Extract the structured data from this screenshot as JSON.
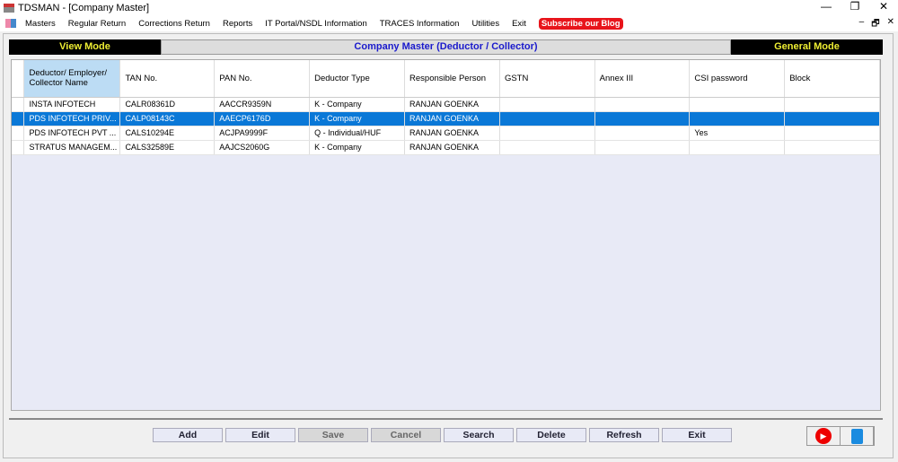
{
  "window": {
    "title": "TDSMAN - [Company Master]",
    "controls": [
      "—",
      "❐",
      "✕"
    ],
    "mdi_controls": [
      "–",
      "🗗",
      "✕"
    ]
  },
  "menu": [
    "Masters",
    "Regular Return",
    "Corrections Return",
    "Reports",
    "IT Portal/NSDL Information",
    "TRACES Information",
    "Utilities",
    "Exit"
  ],
  "blog_label": "Subscribe our Blog",
  "modebar": {
    "left": "View Mode",
    "center": "Company Master (Deductor / Collector)",
    "right": "General Mode"
  },
  "columns": [
    "Deductor/ Employer/ Collector Name",
    "TAN No.",
    "PAN No.",
    "Deductor Type",
    "Responsible Person",
    "GSTN",
    "Annex III",
    "CSI password",
    "Block"
  ],
  "rows": [
    [
      "INSTA INFOTECH",
      "CALR08361D",
      "AACCR9359N",
      "K - Company",
      "RANJAN  GOENKA",
      "",
      "",
      "",
      ""
    ],
    [
      "PDS INFOTECH PRIV...",
      "CALP08143C",
      "AAECP6176D",
      "K - Company",
      "RANJAN  GOENKA",
      "",
      "",
      "",
      ""
    ],
    [
      "PDS INFOTECH PVT ...",
      "CALS10294E",
      "ACJPA9999F",
      "Q - Individual/HUF",
      "RANJAN  GOENKA",
      "",
      "",
      "Yes",
      ""
    ],
    [
      "STRATUS MANAGEM...",
      "CALS32589E",
      "AAJCS2060G",
      "K - Company",
      "RANJAN  GOENKA",
      "",
      "",
      "",
      ""
    ]
  ],
  "selected_row": 1,
  "buttons": [
    {
      "label": "Add",
      "enabled": true
    },
    {
      "label": "Edit",
      "enabled": true
    },
    {
      "label": "Save",
      "enabled": false
    },
    {
      "label": "Cancel",
      "enabled": false
    },
    {
      "label": "Search",
      "enabled": true
    },
    {
      "label": "Delete",
      "enabled": true
    },
    {
      "label": "Refresh",
      "enabled": true
    },
    {
      "label": "Exit",
      "enabled": true
    }
  ],
  "icons": {
    "youtube": "▶"
  }
}
